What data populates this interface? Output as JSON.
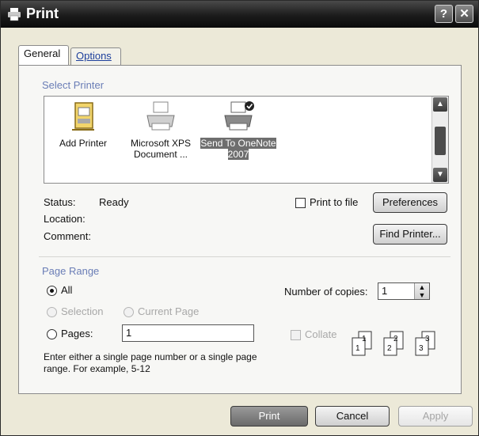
{
  "window": {
    "title": "Print"
  },
  "titlebar": {
    "help_label": "?",
    "close_label": "✕"
  },
  "tabs": [
    {
      "label": "General",
      "active": true
    },
    {
      "label": "Options",
      "active": false
    }
  ],
  "select_printer": {
    "label": "Select Printer",
    "printers": [
      {
        "name": "Add Printer",
        "icon": "add-printer-icon",
        "selected": false
      },
      {
        "name": "Microsoft XPS Document ...",
        "icon": "printer-icon",
        "selected": false
      },
      {
        "name": "Send To OneNote 2007",
        "icon": "default-printer-icon",
        "selected": true
      }
    ]
  },
  "info": {
    "status_label": "Status:",
    "status_value": "Ready",
    "location_label": "Location:",
    "location_value": "",
    "comment_label": "Comment:",
    "comment_value": ""
  },
  "print_to_file": {
    "label": "Print to file",
    "checked": false
  },
  "buttons": {
    "preferences": "Preferences",
    "find_printer": "Find Printer...",
    "print": "Print",
    "cancel": "Cancel",
    "apply": "Apply"
  },
  "page_range": {
    "label": "Page Range",
    "all_label": "All",
    "selection_label": "Selection",
    "current_page_label": "Current Page",
    "pages_label": "Pages:",
    "pages_value": "1",
    "hint": "Enter either a single page number or a single page range.  For example, 5-12",
    "selected": "All"
  },
  "copies": {
    "label": "Number of copies:",
    "value": "1",
    "collate_label": "Collate",
    "collate_checked": false,
    "collate_pages_1": [
      "1",
      "1"
    ],
    "collate_pages_2": [
      "2",
      "2"
    ],
    "collate_pages_3": [
      "3",
      "3"
    ]
  }
}
